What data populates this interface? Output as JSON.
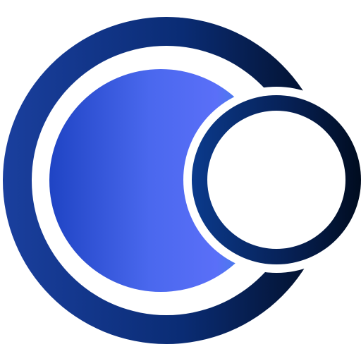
{
  "logo": {
    "outer_ring_colors": [
      "#1a3f9e",
      "#0a2c74",
      "#020e24"
    ],
    "inner_disc_colors": [
      "#1f44c4",
      "#4a68ee",
      "#5a6ff8",
      "#2f8fd8"
    ],
    "moon_ring_colors": [
      "#0b3a8c",
      "#061f52",
      "#000c1f"
    ],
    "moon_fill_color": "#ffffff"
  }
}
